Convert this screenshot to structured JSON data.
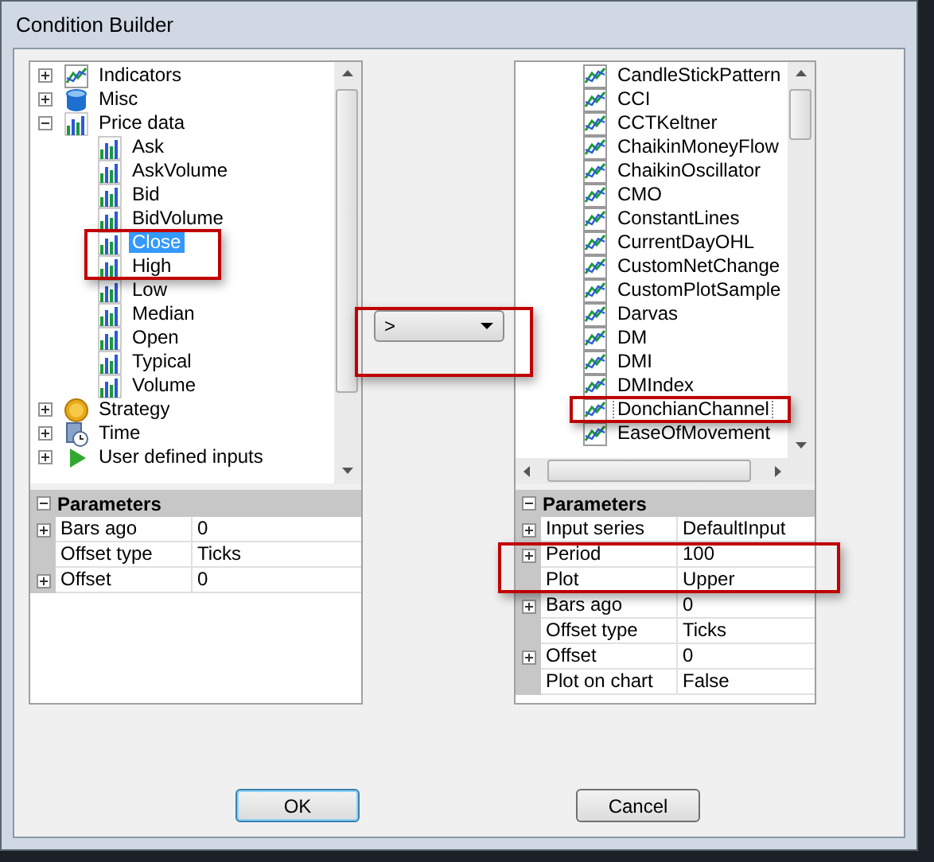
{
  "window": {
    "title": "Condition Builder"
  },
  "left_tree": [
    {
      "label": "Indicators",
      "kind": "linechart",
      "expanded": false,
      "selected": false
    },
    {
      "label": "Misc",
      "kind": "drum",
      "expanded": false,
      "selected": false
    },
    {
      "label": "Price data",
      "kind": "bars",
      "expanded": true,
      "selected": false,
      "children": [
        {
          "label": "Ask",
          "selected": false
        },
        {
          "label": "AskVolume",
          "selected": false
        },
        {
          "label": "Bid",
          "selected": false
        },
        {
          "label": "BidVolume",
          "selected": false
        },
        {
          "label": "Close",
          "selected": true
        },
        {
          "label": "High",
          "selected": false
        },
        {
          "label": "Low",
          "selected": false
        },
        {
          "label": "Median",
          "selected": false
        },
        {
          "label": "Open",
          "selected": false
        },
        {
          "label": "Typical",
          "selected": false
        },
        {
          "label": "Volume",
          "selected": false
        }
      ]
    },
    {
      "label": "Strategy",
      "kind": "coin",
      "expanded": false,
      "selected": false
    },
    {
      "label": "Time",
      "kind": "clock",
      "expanded": false,
      "selected": false
    },
    {
      "label": "User defined inputs",
      "kind": "flag",
      "expanded": false,
      "selected": false
    }
  ],
  "left_parameters": {
    "title": "Parameters",
    "expanded": true,
    "rows": [
      {
        "name": "Bars ago",
        "value": "0",
        "expandable": true
      },
      {
        "name": "Offset type",
        "value": "Ticks",
        "expandable": false
      },
      {
        "name": "Offset",
        "value": "0",
        "expandable": true
      }
    ]
  },
  "operator": {
    "value": ">"
  },
  "right_list": [
    {
      "label": "CandleStickPattern",
      "selected": false
    },
    {
      "label": "CCI",
      "selected": false
    },
    {
      "label": "CCTKeltner",
      "selected": false
    },
    {
      "label": "ChaikinMoneyFlow",
      "selected": false
    },
    {
      "label": "ChaikinOscillator",
      "selected": false
    },
    {
      "label": "CMO",
      "selected": false
    },
    {
      "label": "ConstantLines",
      "selected": false
    },
    {
      "label": "CurrentDayOHL",
      "selected": false
    },
    {
      "label": "CustomNetChange",
      "selected": false
    },
    {
      "label": "CustomPlotSample",
      "selected": false
    },
    {
      "label": "Darvas",
      "selected": false
    },
    {
      "label": "DM",
      "selected": false
    },
    {
      "label": "DMI",
      "selected": false
    },
    {
      "label": "DMIndex",
      "selected": false
    },
    {
      "label": "DonchianChannel",
      "selected": true
    },
    {
      "label": "EaseOfMovement",
      "selected": false
    }
  ],
  "right_parameters": {
    "title": "Parameters",
    "expanded": true,
    "rows": [
      {
        "name": "Input series",
        "value": "DefaultInput",
        "expandable": true
      },
      {
        "name": "Period",
        "value": "100",
        "expandable": true
      },
      {
        "name": "Plot",
        "value": "Upper",
        "expandable": false
      },
      {
        "name": "Bars ago",
        "value": "0",
        "expandable": true
      },
      {
        "name": "Offset type",
        "value": "Ticks",
        "expandable": false
      },
      {
        "name": "Offset",
        "value": "0",
        "expandable": true
      },
      {
        "name": "Plot on chart",
        "value": "False",
        "expandable": false
      }
    ]
  },
  "buttons": [
    {
      "label": "OK",
      "kind": "default"
    },
    {
      "label": "Cancel",
      "kind": "normal"
    }
  ]
}
